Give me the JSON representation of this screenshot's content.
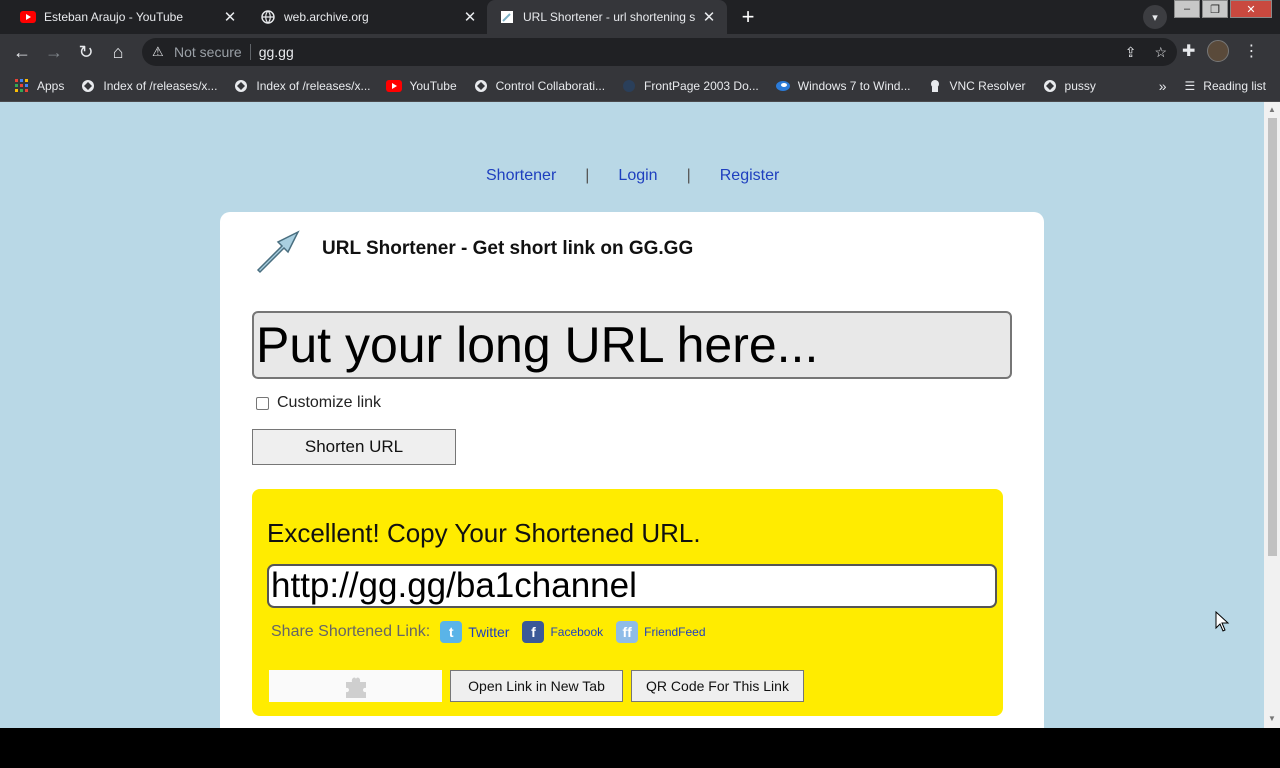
{
  "tabs": [
    {
      "title": "Esteban Araujo - YouTube",
      "icon": "youtube-icon"
    },
    {
      "title": "web.archive.org",
      "icon": "globe-icon"
    },
    {
      "title": "URL Shortener - url shortening s",
      "icon": "page-icon"
    }
  ],
  "address_bar": {
    "security": "Not secure",
    "url": "gg.gg"
  },
  "bookmarks": [
    {
      "label": "Apps",
      "icon": "apps-grid-icon"
    },
    {
      "label": "Index of /releases/x...",
      "icon": "globe-icon"
    },
    {
      "label": "Index of /releases/x...",
      "icon": "globe-icon"
    },
    {
      "label": "YouTube",
      "icon": "youtube-icon"
    },
    {
      "label": "Control Collaborati...",
      "icon": "globe-icon"
    },
    {
      "label": "FrontPage 2003 Do...",
      "icon": "frontpage-icon"
    },
    {
      "label": "Windows 7 to Wind...",
      "icon": "edge-icon"
    },
    {
      "label": "VNC Resolver",
      "icon": "vnc-icon"
    },
    {
      "label": "pussy",
      "icon": "globe-icon"
    }
  ],
  "reading_list": "Reading list",
  "nav": {
    "shortener": "Shortener",
    "login": "Login",
    "register": "Register",
    "separator": "|"
  },
  "page": {
    "title": "URL Shortener - Get short link on GG.GG",
    "long_url_placeholder": "Put your long URL here...",
    "customize_label": "Customize link",
    "shorten_button": "Shorten URL"
  },
  "result": {
    "heading": "Excellent! Copy Your Shortened URL.",
    "short_url": "http://gg.gg/ba1channel",
    "share_label": "Share Shortened Link:",
    "twitter": "Twitter",
    "facebook": "Facebook",
    "friendfeed": "FriendFeed",
    "open_button": "Open Link in New Tab",
    "qr_button": "QR Code For This Link"
  },
  "colors": {
    "page_bg": "#b9d8e6",
    "result_bg": "#ffec00",
    "link": "#1e3fbf"
  }
}
